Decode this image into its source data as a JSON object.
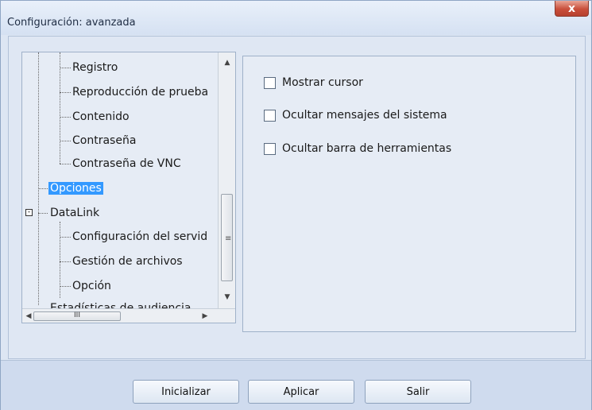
{
  "window": {
    "title": "Configuración: avanzada",
    "close_label": "x"
  },
  "tree": {
    "items": [
      {
        "label": "Registro"
      },
      {
        "label": "Reproducción de prueba"
      },
      {
        "label": "Contenido"
      },
      {
        "label": "Contraseña"
      },
      {
        "label": "Contraseña de VNC"
      },
      {
        "label": "Opciones",
        "selected": true
      },
      {
        "label": "DataLink",
        "expander": "-"
      },
      {
        "label": "Configuración del servid"
      },
      {
        "label": "Gestión de archivos"
      },
      {
        "label": "Opción"
      },
      {
        "label": "Estadísticas de audiencia"
      }
    ],
    "scroll_grip": "≡",
    "hscroll_grip": "III",
    "arrow_up": "▲",
    "arrow_down": "▼",
    "arrow_left": "◀",
    "arrow_right": "▶"
  },
  "options": [
    {
      "label": "Mostrar cursor",
      "checked": false
    },
    {
      "label": "Ocultar mensajes del sistema",
      "checked": false
    },
    {
      "label": "Ocultar barra de herramientas",
      "checked": false
    }
  ],
  "buttons": {
    "initialize": "Inicializar",
    "apply": "Aplicar",
    "exit": "Salir"
  }
}
